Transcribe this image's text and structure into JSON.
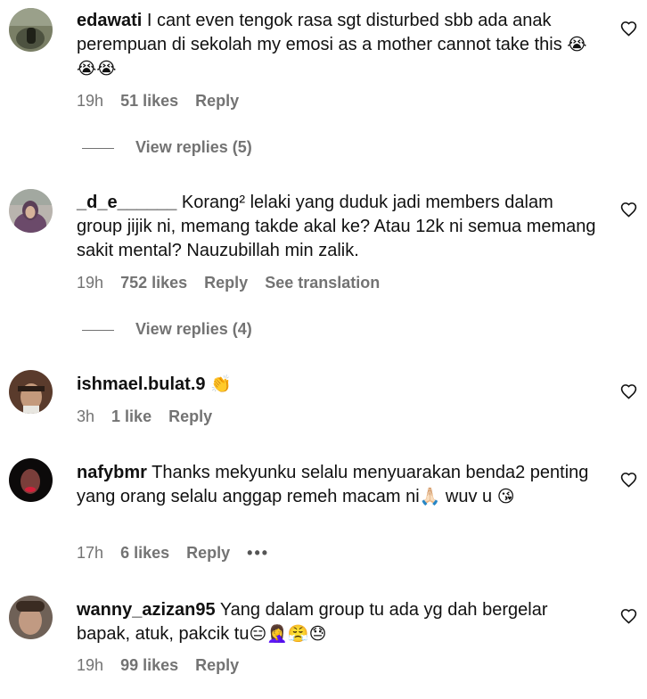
{
  "comments": [
    {
      "username": "edawati",
      "text": "I cant even tengok rasa sgt disturbed sbb ada anak perempuan di sekolah my emosi as a mother cannot take this",
      "emoji": "😭😭😭",
      "time": "19h",
      "likes": "51 likes",
      "reply": "Reply",
      "view_replies": "View replies (5)"
    },
    {
      "username": "_d_e______",
      "text": "Korang² lelaki yang duduk jadi members dalam group jijik ni, memang takde akal ke? Atau 12k ni semua memang sakit mental? Nauzubillah min zalik.",
      "time": "19h",
      "likes": "752 likes",
      "reply": "Reply",
      "translation": "See translation",
      "view_replies": "View replies (4)"
    },
    {
      "username": "ishmael.bulat.9",
      "text": "",
      "emoji": "👏",
      "time": "3h",
      "likes": "1 like",
      "reply": "Reply"
    },
    {
      "username": "nafybmr",
      "text": "Thanks mekyunku selalu menyuarakan benda2 penting yang orang selalu anggap remeh macam ni",
      "emoji_mid": "🙏🏻",
      "text_tail": " wuv u",
      "emoji": "😘",
      "time": "17h",
      "likes": "6 likes",
      "reply": "Reply",
      "more": "•••"
    },
    {
      "username": "wanny_azizan95",
      "text": "Yang dalam group tu ada yg dah bergelar bapak, atuk, pakcik tu",
      "emoji": "😑🤦‍♀️😤😓",
      "time": "19h",
      "likes": "99 likes",
      "reply": "Reply"
    }
  ],
  "icons": {
    "like": "heart-outline-icon",
    "more": "more-options-icon"
  }
}
